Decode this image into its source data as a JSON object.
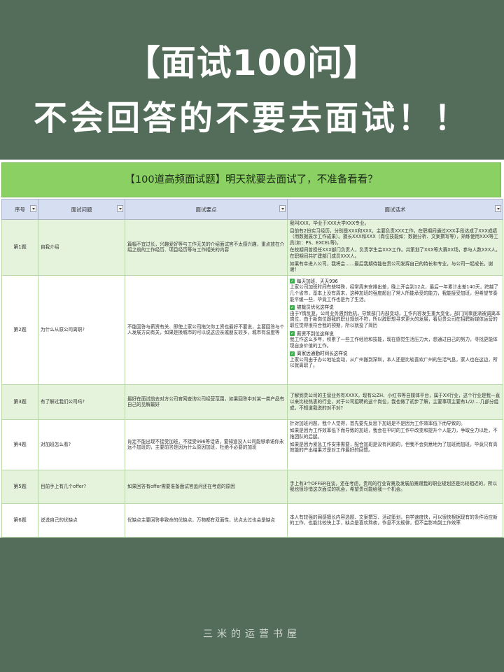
{
  "hero": {
    "title": "【面试100问】",
    "subtitle": "不会回答的不要去面试！！"
  },
  "sheet": {
    "title": "【100道高频面试题】明天就要去面试了，不准备看看？",
    "headers": [
      "序号",
      "面试问题",
      "面试要点",
      "面试话术"
    ],
    "rows": [
      {
        "num": "第1题",
        "question": "自我介绍",
        "points": "篇幅不宜过长，兴趣爱好等与工作无关的介绍面试官不太感兴趣，重点放在介绍之前的工作经历、项目经历等与工作相关的内容",
        "answer": [
          "我叫XXX，毕业于XXX大学XXX专业。",
          "目前有2份实习经历，分别是XXX和XXX，主要负责XXX工作。在职期间通过XXX手段达成了XXX成绩（用数据展示工作成果）。擅长XXX和XXX（岗位技能如：数据分析、文案撰写等），熟练使用XXX等工具(如：PS、EXCEL等)。",
          "在校期间曾担任XXX部门负责人，负责学生会XXX工作。共策划了XXX等大赛XX场，参与人数XXX人。在职期间共扩建部门成员XXX人。",
          "如果有幸进入公司，我将会……最后我期待能在贵公司发挥自己的特长和专业，与公司一起成长，谢谢！"
        ]
      },
      {
        "num": "第2题",
        "question": "为什么从原公司离职?",
        "points": "不能回答与薪资有关、即使上家公司拖欠你工资也最好不要说，主要回答与个人发展方向有关，如果是换城市的可以说这边亲戚朋友较多，城市有温度等",
        "answer": [
          {
            "title": "每天加班、天天996",
            "text": "上家公司加班时间有些特殊，经常周末安排出差，晚上开会到12点，最后一年累计出差140天，跨越了几个省市，基本上没有周末，这种加班的强度超出了常人所能承受的能力，我能接受加班，但希望节奏能平缓一些，毕竟工作也是为了生活。"
          },
          {
            "title": "被裁员优化这样说",
            "text": "由于Y情反复，公司业务遇到危机，导致部门内部变动，工作内容发生重大变化，部门同事逐渐被调离本岗位，由于新岗位跟我的职业规划不符，所以辞职想寻求更大的发展，看见贵公司在招聘新媒体运营的职位觉得很符合我的预期，所以就投了简历"
          },
          {
            "title": "薪资不到位这样说",
            "text": "我工作这么多年，积累了一些工作经验和技能，现在感觉生活压力大，想通过自己的努力，寻找更能体现自身价值的工作。"
          },
          {
            "title": "离家远通勤时间长这样说",
            "text": "上家公司由于办公地址变动，从广州搬到深圳，本人还是比较喜欢广州的生活气息，家人也在这边，所以就离职了。"
          }
        ]
      },
      {
        "num": "第3题",
        "question": "有了解过我们公司吗?",
        "points": "最好在面试前去对方公司官网查询公司经营范围，如果回答中对某一类产品有自己的见解最好",
        "answer": [
          "了解到贵公司的主营业务有XXXX，现有公ZH、小红书等自媒体平台，属于XX行业，这个行业是我一直以来比较热衷的行业，对于公司招聘的这个岗位，我也做了初步了解，主要事项主要有1/2/....几部分组成，不知道我说的对不对?"
        ]
      },
      {
        "num": "第4题",
        "question": "对加班怎么看?",
        "points": "肯定不能出现不接受加班，不接受996等话语，要知道没人公司能够承诺你永远不加班的，主要前答是因为什么原因加班，杜绝不必要的加班",
        "answer": [
          "针对加班问题，我个人觉得，首先要先反思下加班是不是因为工作效率低下而导致的。",
          "如果是因为工作效率低下而导致的加班，我会在平时的工作中改变和提升个人能力，争取全力以赴，不拖团队的后腿。",
          "如果是因为紧急工作安排需要，配合加班是没有问题的，但我不会刻意地为了加班而加班，毕竟只有高效能的产出结果才是对工作最好的回馈。"
        ]
      },
      {
        "num": "第5题",
        "question": "目前手上有几个offer?",
        "points": "如果回答有offer需要准备面试官追问还在考虑的原因",
        "answer": [
          "手上有3个OFFER在谈，还在考虑，贵司的行业背景及发展前景跟我的职业规划还是比较相近的，所以我也很珍惜这次面试的机会，希望贵司能给我一个机会。"
        ]
      },
      {
        "num": "第6题",
        "question": "说说自己的优缺点",
        "points": "优缺点主要回答非致命的优缺点，万物都有双面性，优点太过也会是缺点",
        "answer": [
          "本人有较强的网感擅长内容选题、文案撰写、活动策划，自学速度快，可以很快根据现有的条件适应新的工作，也能比较快上手，缺点是喜欢熬夜，作息不太规律，但不会影响到工作效率"
        ]
      }
    ]
  },
  "watermark": "三米的运营书屋"
}
